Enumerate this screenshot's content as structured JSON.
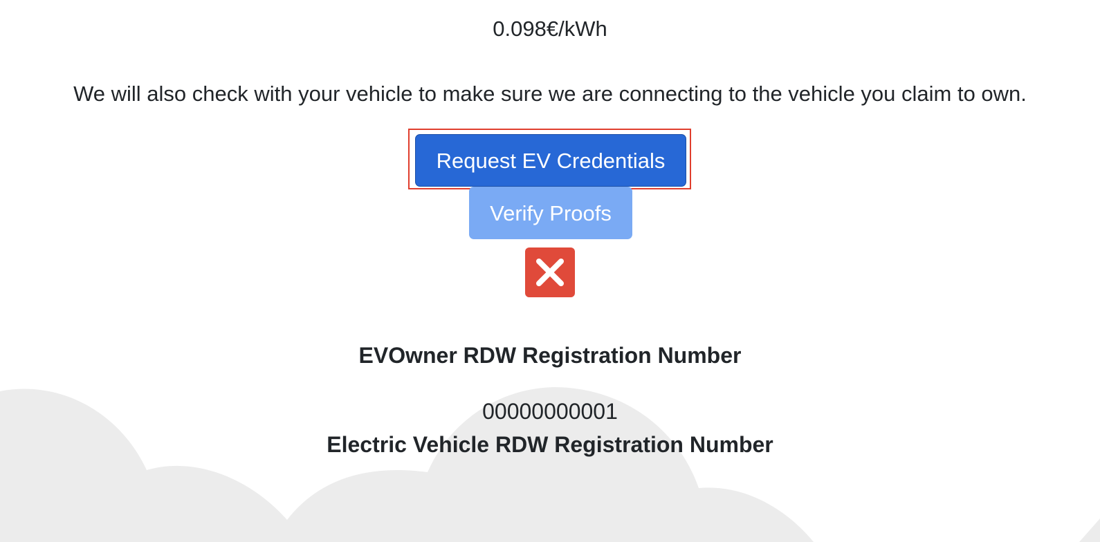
{
  "pricing": {
    "rate": "0.098€/kWh"
  },
  "notice": {
    "text": "We will also check with your vehicle to make sure we are connecting to the vehicle you claim to own."
  },
  "actions": {
    "request_label": "Request EV Credentials",
    "verify_label": "Verify Proofs",
    "close_icon": "close-icon"
  },
  "fields": {
    "owner_label": "EVOwner RDW Registration Number",
    "owner_value": "00000000001",
    "vehicle_label": "Electric Vehicle RDW Registration Number"
  },
  "colors": {
    "primary_button": "#2768d6",
    "disabled_button": "#7aaaf4",
    "danger": "#e04a3a",
    "highlight_border": "#e03e2d",
    "cloud": "#ececec"
  }
}
